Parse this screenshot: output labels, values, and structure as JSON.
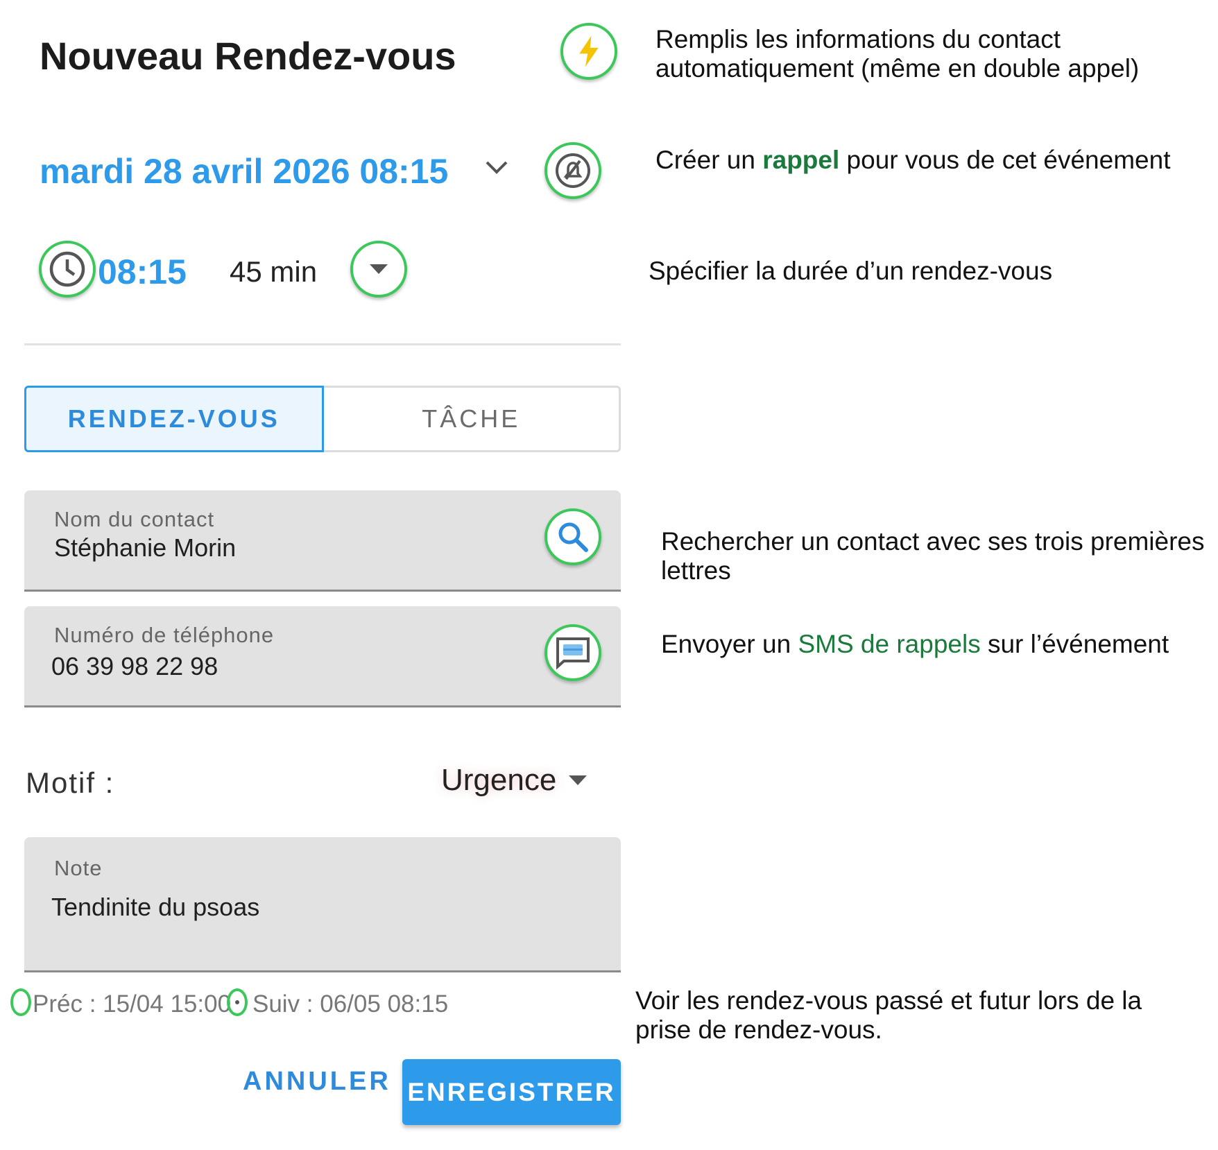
{
  "header": {
    "title": "Nouveau Rendez-vous"
  },
  "schedule": {
    "date": "mardi 28 avril 2026 08:15",
    "time": "08:15",
    "duration": "45 min"
  },
  "tabs": [
    {
      "label": "RENDEZ-VOUS",
      "active": true
    },
    {
      "label": "TÂCHE",
      "active": false
    }
  ],
  "contact": {
    "label": "Nom du contact",
    "value": "Stéphanie Morin"
  },
  "phone": {
    "label": "Numéro de téléphone",
    "value": "06 39 98 22 98"
  },
  "motif": {
    "label": "Motif :",
    "value": "Urgence"
  },
  "note": {
    "label": "Note",
    "value": "Tendinite du psoas"
  },
  "history": {
    "prev": "Préc : 15/04 15:00",
    "next": "Suiv : 06/05 08:15"
  },
  "actions": {
    "cancel": "ANNULER",
    "save": "ENREGISTRER"
  },
  "annotations": {
    "autofill_line1": "Remplis les informations du contact",
    "autofill_line2": "automatiquement (même en double appel)",
    "reminder_pre": "Créer un ",
    "reminder_hl": "rappel",
    "reminder_post": " pour vous de cet événement",
    "duration": "Spécifier la durée d’un rendez-vous",
    "search_line1": "Rechercher un contact avec ses trois premières",
    "search_line2": "lettres",
    "sms_pre": "Envoyer un ",
    "sms_hl": "SMS de rappels",
    "sms_post": " sur l’événement",
    "history_line1": "Voir les rendez-vous passé et futur lors de la",
    "history_line2": "prise de rendez-vous."
  },
  "colors": {
    "accent": "#2e9bea",
    "highlight_ring": "#3cc75a",
    "annotation_highlight": "#1a7a3c"
  },
  "icons": [
    "lightning-icon",
    "bell-off-icon",
    "chevron-down-icon",
    "clock-icon",
    "dropdown-icon",
    "search-icon",
    "sms-icon"
  ]
}
